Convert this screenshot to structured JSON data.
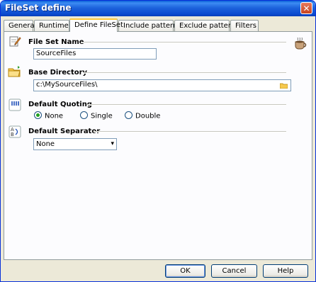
{
  "window": {
    "title": "FileSet define",
    "close_icon": "close-icon"
  },
  "tabs": [
    {
      "label": "General",
      "active": false
    },
    {
      "label": "Runtime",
      "active": false
    },
    {
      "label": "Define FileSet",
      "active": true
    },
    {
      "label": "Include patterns",
      "active": false
    },
    {
      "label": "Exclude patterns",
      "active": false
    },
    {
      "label": "Filters",
      "active": false
    }
  ],
  "fileset_name": {
    "label": "File Set Name",
    "value": "SourceFiles",
    "icon": "pencil-note-icon"
  },
  "base_directory": {
    "label": "Base Directory",
    "value": "c:\\MySourceFiles\\",
    "icon": "folder-icon",
    "browse_icon": "folder-browse-icon"
  },
  "default_quoting": {
    "label": "Default Quoting",
    "icon": "quotes-icon",
    "options": [
      {
        "label": "None",
        "checked": true
      },
      {
        "label": "Single",
        "checked": false
      },
      {
        "label": "Double",
        "checked": false
      }
    ]
  },
  "default_separator": {
    "label": "Default Separator",
    "selected": "None",
    "icon": "separator-icon"
  },
  "decor": {
    "icon": "coffee-cup-icon"
  },
  "buttons": {
    "ok": "OK",
    "cancel": "Cancel",
    "help": "Help"
  },
  "colors": {
    "titlebar": "#0a4bd0",
    "panel": "#fcfcfe",
    "window": "#ece9d8",
    "accent_tab": "#ffc83c"
  }
}
